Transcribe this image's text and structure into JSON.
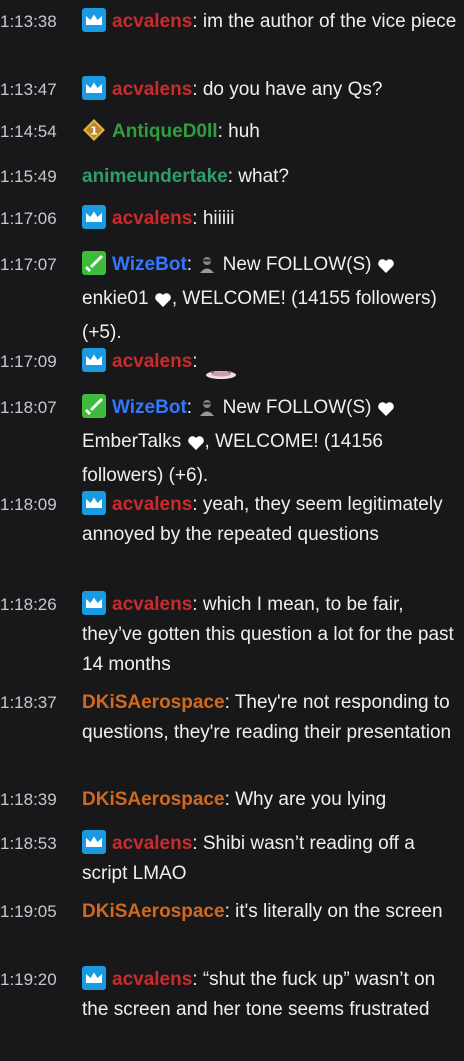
{
  "colors": {
    "background": "#18181b",
    "text": "#efeff1",
    "acvalens": "#cc2a2a",
    "antique": "#2e9e3e",
    "anime": "#2e9e6a",
    "wizebot": "#3377ff",
    "dkisa": "#d2691e",
    "broadcaster_badge": "#1a9ae0"
  },
  "messages": [
    {
      "time": "1:13:38",
      "user": "acvalens",
      "text": "im the author of the vice piece",
      "badge": "crown-badge-icon"
    },
    {
      "time": "1:13:47",
      "user": "acvalens",
      "text": "do you have any Qs?",
      "badge": "crown-badge-icon"
    },
    {
      "time": "1:14:54",
      "user": "AntiqueD0ll",
      "text": "huh",
      "badge": "rank-1-badge-icon"
    },
    {
      "time": "1:15:49",
      "user": "animeundertake",
      "text": "what?",
      "badge": ""
    },
    {
      "time": "1:17:06",
      "user": "acvalens",
      "text": "hiiiii",
      "badge": "crown-badge-icon"
    },
    {
      "time": "1:17:07",
      "user": "WizeBot",
      "text_a": "New FOLLOW(S)",
      "text_b": "enkie01",
      "text_c": ", WELCOME! (14155 followers) (+5).",
      "badge": "sword-badge-icon"
    },
    {
      "time": "1:17:09",
      "user": "acvalens",
      "text": "",
      "badge": "crown-badge-icon"
    },
    {
      "time": "1:18:07",
      "user": "WizeBot",
      "text_a": "New FOLLOW(S)",
      "text_b": "EmberTalks",
      "text_c": ", WELCOME! (14156 followers) (+6).",
      "badge": "sword-badge-icon"
    },
    {
      "time": "1:18:09",
      "user": "acvalens",
      "text": "yeah, they seem legitimately annoyed by the repeated questions",
      "badge": "crown-badge-icon"
    },
    {
      "time": "1:18:26",
      "user": "acvalens",
      "text": "which I mean, to be fair, they’ve gotten this question a lot for the past 14 months",
      "badge": "crown-badge-icon"
    },
    {
      "time": "1:18:37",
      "user": "DKiSAerospace",
      "text": "They're not responding to questions, they're reading their presentation",
      "badge": ""
    },
    {
      "time": "1:18:39",
      "user": "DKiSAerospace",
      "text": "Why are you lying",
      "badge": ""
    },
    {
      "time": "1:18:53",
      "user": "acvalens",
      "text": "Shibi wasn’t reading off a script LMAO",
      "badge": "crown-badge-icon"
    },
    {
      "time": "1:19:05",
      "user": "DKiSAerospace",
      "text": "it's literally on the screen",
      "badge": ""
    },
    {
      "time": "1:19:20",
      "user": "acvalens",
      "text": "“shut the fuck up” wasn’t on the screen and her tone seems frustrated",
      "badge": "crown-badge-icon"
    }
  ]
}
